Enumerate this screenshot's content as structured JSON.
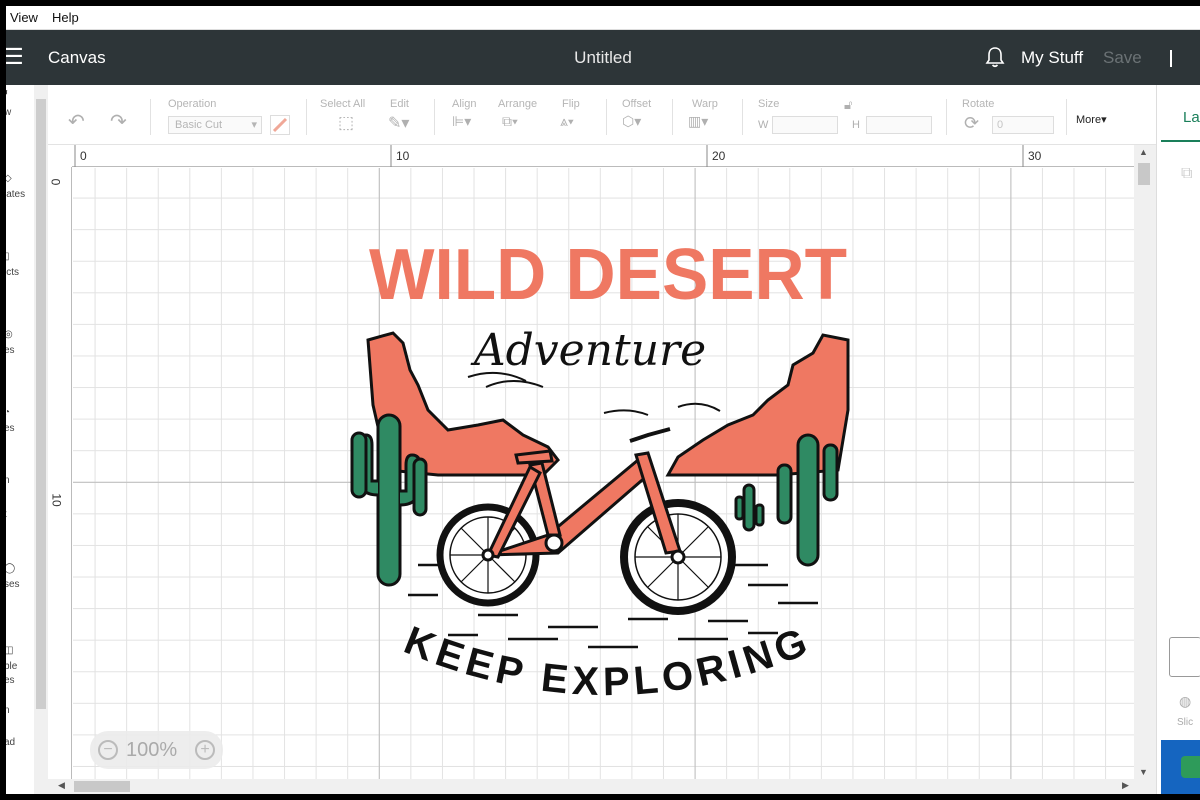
{
  "menubar": {
    "view": "View",
    "help": "Help"
  },
  "header": {
    "section": "Canvas",
    "doc_title": "Untitled",
    "my_stuff": "My Stuff",
    "save": "Save"
  },
  "leftbar": {
    "items": [
      "w",
      "lates",
      "jcts",
      "es",
      "es",
      "n",
      "t",
      "ses",
      "ble",
      "es",
      "n",
      "ad"
    ]
  },
  "toolbar": {
    "operation_label": "Operation",
    "operation_value": "Basic Cut",
    "select_all": "Select All",
    "edit": "Edit",
    "align": "Align",
    "arrange": "Arrange",
    "flip": "Flip",
    "offset": "Offset",
    "warp": "Warp",
    "size": "Size",
    "w": "W",
    "h": "H",
    "rotate": "Rotate",
    "rotate_value": "0",
    "more": "More"
  },
  "right_panel": {
    "tab": "La",
    "slice_label": "Slic"
  },
  "ruler": {
    "top": [
      "0",
      "10",
      "20",
      "30"
    ],
    "left": [
      "0",
      "10"
    ]
  },
  "zoom": {
    "value": "100%",
    "minus": "−",
    "plus": "+"
  },
  "artwork": {
    "title": "WILD DESERT",
    "script": "Adventure",
    "tagline": "KEEP EXPLORING",
    "colors": {
      "coral": "#ef7862",
      "cactus": "#2f8a63",
      "ink": "#111111"
    }
  },
  "colors": {
    "header_bg": "#2d3538",
    "accent_green": "#1a7f5a",
    "accent_blue": "#1565c0"
  }
}
